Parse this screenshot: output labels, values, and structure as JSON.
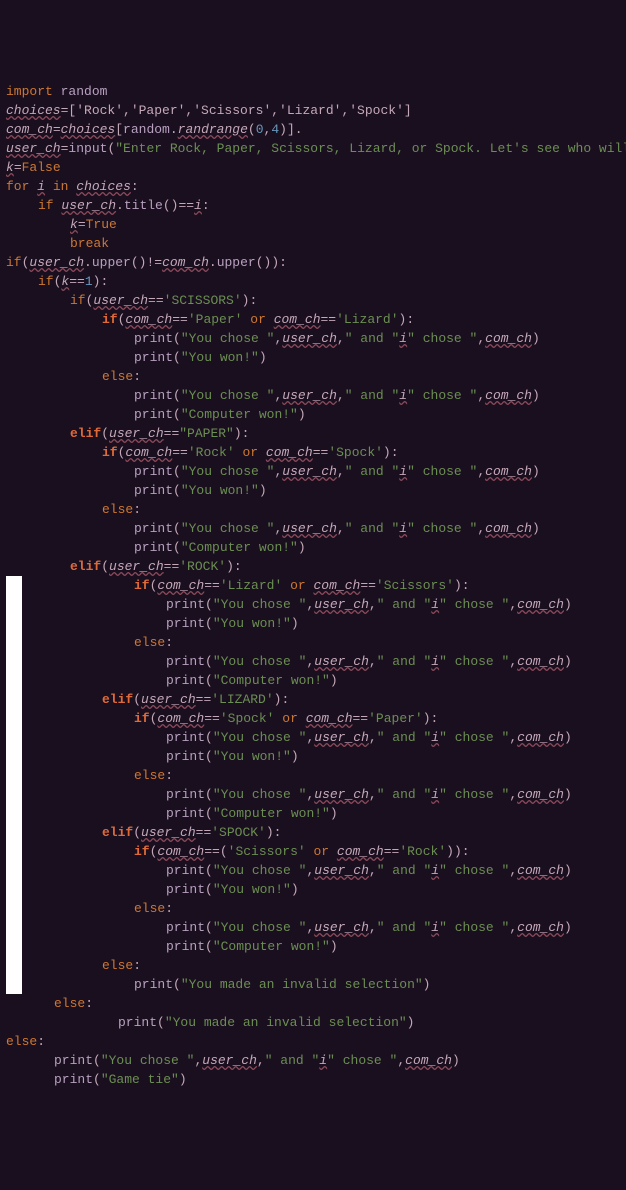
{
  "tokens": {
    "import": "import",
    "random": "random",
    "choices": "choices",
    "list_literal": "=['Rock','Paper','Scissors','Lizard','Spock']",
    "com_ch": "com_ch",
    "eq": "=",
    "lbracket": "[",
    "rbracket": "]",
    "dot": ".",
    "randrange": "randrange",
    "lparen": "(",
    "rparen": ")",
    "zero": "0",
    "comma": ",",
    "four": "4",
    "user_ch": "user_ch",
    "input": "input",
    "input_prompt": "\"Enter Rock, Paper, Scissors, Lizard, or Spock. Let's see who will win: \"",
    "upper": "upper",
    "k": "k",
    "false": "False",
    "true": "True",
    "for": "for",
    "i": "i",
    "in": "in",
    "colon": ":",
    "if": "if",
    "title": "title",
    "eqeq": "==",
    "break": "break",
    "neq": "!=",
    "one": "1",
    "scissors_u": "'SCISSORS'",
    "paper_l": "'Paper'",
    "or": "or",
    "lizard_l": "'Lizard'",
    "print": "print",
    "you_chose": "\"You chose \"",
    "and_txt": "\" and \"",
    "chose_txt": "\" chose \"",
    "you_won": "\"You won!\"",
    "else": "else",
    "comp_won": "\"Computer won!\"",
    "elif": "elif",
    "paper_u": "\"PAPER\"",
    "rock_l": "'Rock'",
    "spock_l": "'Spock'",
    "rock_u": "'ROCK'",
    "scissors_l": "'Scissors'",
    "lizard_u": "'LIZARD'",
    "spock_u": "'SPOCK'",
    "invalid": "\"You made an invalid selection\"",
    "game_tie": "\"Game tie\""
  }
}
